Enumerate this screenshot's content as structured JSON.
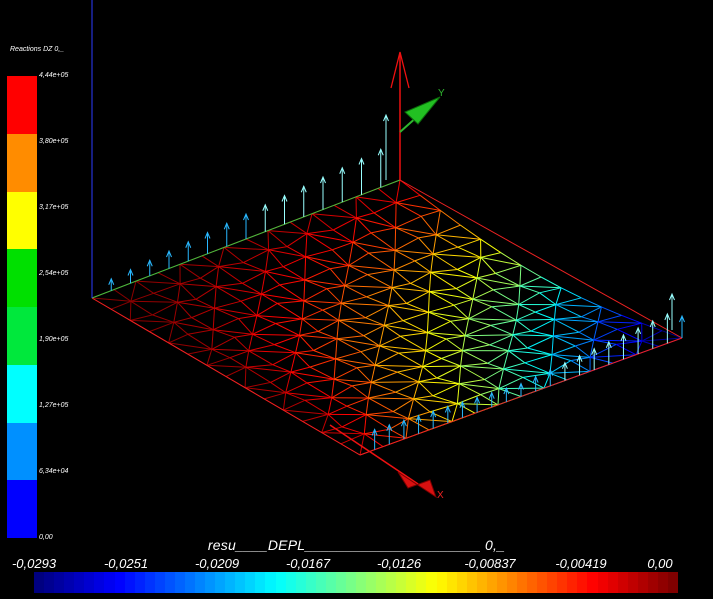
{
  "vertical_legend": {
    "title": "Reactions DZ 0,_",
    "ticks": [
      "4,44e+05",
      "3,80e+05",
      "3,17e+05",
      "2,54e+05",
      "1,90e+05",
      "1,27e+05",
      "6,34e+04",
      "0,00"
    ],
    "bands": [
      "#ff0000",
      "#ff8c00",
      "#ffff00",
      "#00e000",
      "#00e83c",
      "#00ffff",
      "#0090ff",
      "#0000ff"
    ]
  },
  "horizontal_legend": {
    "title": "resu____DEPL______________________ 0,_",
    "ticks": [
      "-0,0293",
      "-0,0251",
      "-0,0209",
      "-0,0167",
      "-0,0126",
      "-0,00837",
      "-0,00419",
      "0,00"
    ]
  },
  "axes": {
    "x_label": "X",
    "y_label": "Y"
  },
  "colors": {
    "background": "#000000",
    "x_axis": "#ff0000",
    "y_axis": "#00c000",
    "z_axis": "#ff0000"
  }
}
